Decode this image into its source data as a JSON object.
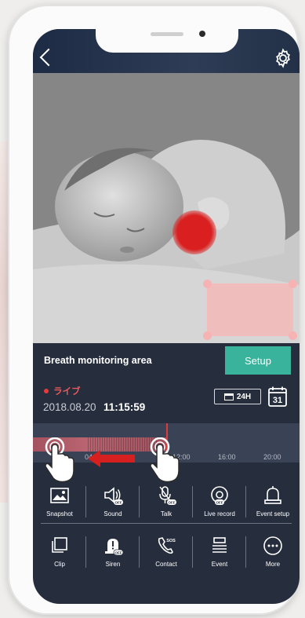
{
  "header": {
    "back_icon": "chevron-left-icon",
    "settings_icon": "gear-icon"
  },
  "panel": {
    "title": "Breath monitoring area",
    "setup_label": "Setup",
    "live_label": "ライブ",
    "date": "2018.08.20",
    "time": "11:15:59",
    "range_label": "24H",
    "calendar_day": "31"
  },
  "timeline": {
    "ticks": [
      "04",
      "12:00",
      "16:00",
      "20:00"
    ],
    "hint": "swipe-left"
  },
  "actions_row1": [
    {
      "label": "Snapshot",
      "icon": "image-icon"
    },
    {
      "label": "Sound",
      "icon": "speaker-off-icon"
    },
    {
      "label": "Talk",
      "icon": "mic-off-icon"
    },
    {
      "label": "Live record",
      "icon": "record-icon"
    },
    {
      "label": "Event setup",
      "icon": "bell-icon"
    }
  ],
  "actions_row2": [
    {
      "label": "Clip",
      "icon": "clip-icon"
    },
    {
      "label": "Siren",
      "icon": "siren-off-icon"
    },
    {
      "label": "Contact",
      "icon": "phone-sos-icon"
    },
    {
      "label": "Event",
      "icon": "event-list-icon"
    },
    {
      "label": "More",
      "icon": "more-icon"
    }
  ],
  "badges": {
    "off": "OFF",
    "sos": "SOS"
  },
  "colors": {
    "accent": "#39b39b",
    "live": "#e53b3b",
    "background": "#262d3d"
  }
}
